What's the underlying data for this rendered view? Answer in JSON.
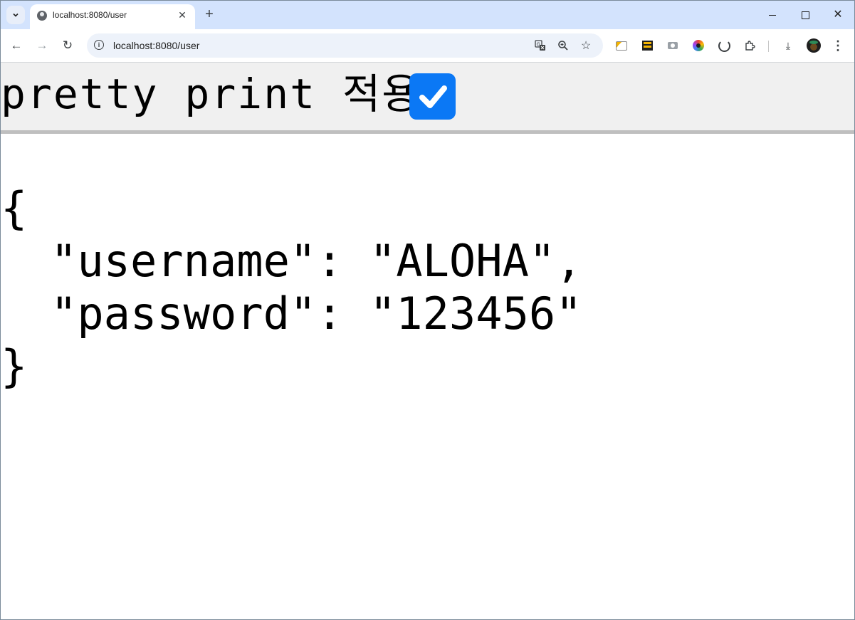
{
  "browser": {
    "tab": {
      "title": "localhost:8080/user",
      "close_glyph": "✕"
    },
    "new_tab_glyph": "+",
    "window_controls": {
      "close_glyph": "✕"
    },
    "toolbar": {
      "back_glyph": "←",
      "forward_glyph": "→",
      "reload_glyph": "↻",
      "url": "localhost:8080/user",
      "info_glyph": "i",
      "translate_glyph": "G",
      "zoom_glyph": "⊕",
      "star_glyph": "☆",
      "download_glyph": "⤓",
      "menu_glyph": "⋮"
    }
  },
  "page": {
    "pretty_print_label": "pretty print 적용",
    "pretty_print_checked": true,
    "json": {
      "open_brace": "{",
      "entries": [
        {
          "key": "\"username\": ",
          "value": "\"ALOHA\","
        },
        {
          "key": "\"password\": ",
          "value": "\"123456\""
        }
      ],
      "close_brace": "}"
    }
  },
  "colors": {
    "tab_strip": "#d3e3fd",
    "checkbox": "#0b78f5",
    "pretty_bar": "#f0f0f0"
  }
}
